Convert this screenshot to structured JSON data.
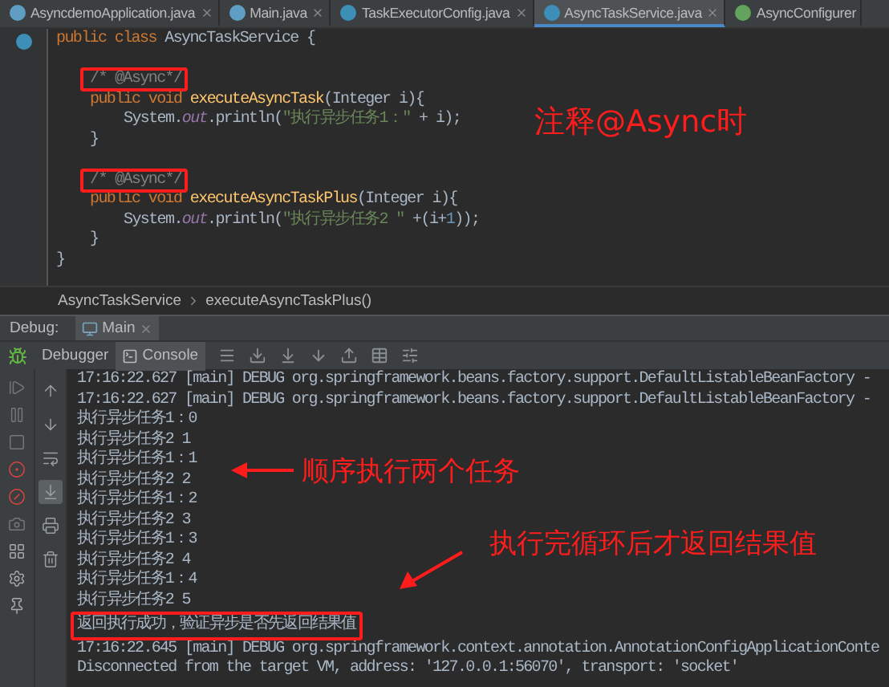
{
  "editor_tabs": [
    {
      "label": "AsyncdemoApplication.java",
      "kind": "app",
      "selected": false
    },
    {
      "label": "Main.java",
      "kind": "app",
      "selected": false
    },
    {
      "label": "TaskExecutorConfig.java",
      "kind": "class",
      "selected": false
    },
    {
      "label": "AsyncTaskService.java",
      "kind": "class",
      "selected": true
    },
    {
      "label": "AsyncConfigurer",
      "kind": "interface",
      "selected": false
    }
  ],
  "code_lines": [
    {
      "kind": "top",
      "tokens": [
        {
          "text": "public class ",
          "kind": "keyword"
        },
        {
          "text": "AsyncTaskService {",
          "kind": "plain"
        }
      ]
    },
    {
      "kind": "blank"
    },
    {
      "kind": "member",
      "tokens": [
        {
          "text": "/* @Async*/",
          "kind": "comment",
          "boxed": true
        }
      ]
    },
    {
      "kind": "member",
      "tokens": [
        {
          "text": "public void ",
          "kind": "keyword"
        },
        {
          "text": "executeAsyncTask",
          "kind": "method"
        },
        {
          "text": "(Integer i){",
          "kind": "plain"
        }
      ]
    },
    {
      "kind": "body",
      "tokens": [
        {
          "text": "System.",
          "kind": "plain"
        },
        {
          "text": "out",
          "kind": "field"
        },
        {
          "text": ".println(",
          "kind": "plain"
        },
        {
          "text": "\"执行异步任务1：\"",
          "kind": "string"
        },
        {
          "text": " + i);",
          "kind": "plain"
        }
      ]
    },
    {
      "kind": "member",
      "tokens": [
        {
          "text": "}",
          "kind": "plain"
        }
      ]
    },
    {
      "kind": "blank"
    },
    {
      "kind": "member",
      "tokens": [
        {
          "text": "/* @Async*/",
          "kind": "comment",
          "boxed": true
        }
      ]
    },
    {
      "kind": "member",
      "tokens": [
        {
          "text": "public void ",
          "kind": "keyword"
        },
        {
          "text": "executeAsyncTaskPlus",
          "kind": "method"
        },
        {
          "text": "(Integer i){",
          "kind": "plain"
        }
      ]
    },
    {
      "kind": "body",
      "tokens": [
        {
          "text": "System.",
          "kind": "plain"
        },
        {
          "text": "out",
          "kind": "field"
        },
        {
          "text": ".println(",
          "kind": "plain"
        },
        {
          "text": "\"执行异步任务2 \"",
          "kind": "string"
        },
        {
          "text": " +(i+",
          "kind": "plain"
        },
        {
          "text": "1",
          "kind": "number"
        },
        {
          "text": "));",
          "kind": "plain"
        }
      ]
    },
    {
      "kind": "member",
      "tokens": [
        {
          "text": "}",
          "kind": "plain"
        }
      ]
    },
    {
      "kind": "top",
      "tokens": [
        {
          "text": "}",
          "kind": "plain"
        }
      ]
    }
  ],
  "breadcrumb": [
    "AsyncTaskService",
    "executeAsyncTaskPlus()"
  ],
  "debug_bar": {
    "label": "Debug:",
    "tab": "Main"
  },
  "debug_tabs": [
    {
      "label": "Debugger",
      "kind": "plain",
      "selected": false
    },
    {
      "label": "Console",
      "kind": "console",
      "selected": true
    }
  ],
  "console_side_tools": [
    {
      "kind": "up",
      "on": false
    },
    {
      "kind": "down",
      "on": false
    },
    {
      "kind": "wrap",
      "on": false
    },
    {
      "kind": "scroll-end",
      "on": true
    },
    {
      "kind": "print",
      "on": false
    },
    {
      "kind": "trash",
      "on": false
    }
  ],
  "console_lines": [
    {
      "text": "17:16:22.627 [main] DEBUG org.springframework.beans.factory.support.DefaultListableBeanFactory -",
      "boxed": false
    },
    {
      "text": "17:16:22.627 [main] DEBUG org.springframework.beans.factory.support.DefaultListableBeanFactory -",
      "boxed": false
    },
    {
      "text": "执行异步任务1：0",
      "boxed": false
    },
    {
      "text": "执行异步任务2 1",
      "boxed": false
    },
    {
      "text": "执行异步任务1：1",
      "boxed": false
    },
    {
      "text": "执行异步任务2 2",
      "boxed": false
    },
    {
      "text": "执行异步任务1：2",
      "boxed": false
    },
    {
      "text": "执行异步任务2 3",
      "boxed": false
    },
    {
      "text": "执行异步任务1：3",
      "boxed": false
    },
    {
      "text": "执行异步任务2 4",
      "boxed": false
    },
    {
      "text": "执行异步任务1：4",
      "boxed": false
    },
    {
      "text": "执行异步任务2 5",
      "boxed": false
    },
    {
      "text": "返回执行成功，验证异步是否先返回结果值",
      "boxed": true
    },
    {
      "text": "17:16:22.645 [main] DEBUG org.springframework.context.annotation.AnnotationConfigApplicationConte",
      "boxed": false
    },
    {
      "text": "Disconnected from the target VM, address: '127.0.0.1:56070', transport: 'socket'",
      "boxed": false
    }
  ],
  "annotations": [
    {
      "text": "注释@Async时",
      "arrow": false
    },
    {
      "text": "顺序执行两个任务",
      "arrow": true
    },
    {
      "text": "执行完循环后才返回结果值",
      "arrow": true
    }
  ]
}
